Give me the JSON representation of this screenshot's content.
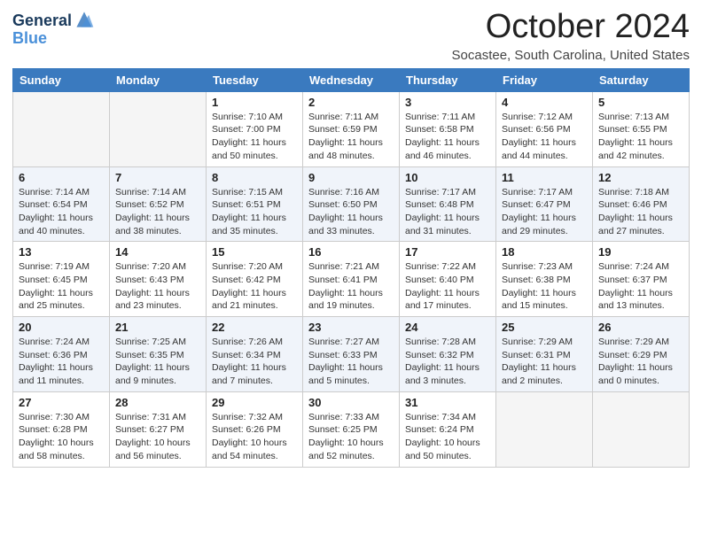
{
  "logo": {
    "line1": "General",
    "line2": "Blue"
  },
  "title": "October 2024",
  "subtitle": "Socastee, South Carolina, United States",
  "days_of_week": [
    "Sunday",
    "Monday",
    "Tuesday",
    "Wednesday",
    "Thursday",
    "Friday",
    "Saturday"
  ],
  "weeks": [
    [
      {
        "day": "",
        "empty": true
      },
      {
        "day": "",
        "empty": true
      },
      {
        "day": "1",
        "sunrise": "Sunrise: 7:10 AM",
        "sunset": "Sunset: 7:00 PM",
        "daylight": "Daylight: 11 hours and 50 minutes."
      },
      {
        "day": "2",
        "sunrise": "Sunrise: 7:11 AM",
        "sunset": "Sunset: 6:59 PM",
        "daylight": "Daylight: 11 hours and 48 minutes."
      },
      {
        "day": "3",
        "sunrise": "Sunrise: 7:11 AM",
        "sunset": "Sunset: 6:58 PM",
        "daylight": "Daylight: 11 hours and 46 minutes."
      },
      {
        "day": "4",
        "sunrise": "Sunrise: 7:12 AM",
        "sunset": "Sunset: 6:56 PM",
        "daylight": "Daylight: 11 hours and 44 minutes."
      },
      {
        "day": "5",
        "sunrise": "Sunrise: 7:13 AM",
        "sunset": "Sunset: 6:55 PM",
        "daylight": "Daylight: 11 hours and 42 minutes."
      }
    ],
    [
      {
        "day": "6",
        "sunrise": "Sunrise: 7:14 AM",
        "sunset": "Sunset: 6:54 PM",
        "daylight": "Daylight: 11 hours and 40 minutes."
      },
      {
        "day": "7",
        "sunrise": "Sunrise: 7:14 AM",
        "sunset": "Sunset: 6:52 PM",
        "daylight": "Daylight: 11 hours and 38 minutes."
      },
      {
        "day": "8",
        "sunrise": "Sunrise: 7:15 AM",
        "sunset": "Sunset: 6:51 PM",
        "daylight": "Daylight: 11 hours and 35 minutes."
      },
      {
        "day": "9",
        "sunrise": "Sunrise: 7:16 AM",
        "sunset": "Sunset: 6:50 PM",
        "daylight": "Daylight: 11 hours and 33 minutes."
      },
      {
        "day": "10",
        "sunrise": "Sunrise: 7:17 AM",
        "sunset": "Sunset: 6:48 PM",
        "daylight": "Daylight: 11 hours and 31 minutes."
      },
      {
        "day": "11",
        "sunrise": "Sunrise: 7:17 AM",
        "sunset": "Sunset: 6:47 PM",
        "daylight": "Daylight: 11 hours and 29 minutes."
      },
      {
        "day": "12",
        "sunrise": "Sunrise: 7:18 AM",
        "sunset": "Sunset: 6:46 PM",
        "daylight": "Daylight: 11 hours and 27 minutes."
      }
    ],
    [
      {
        "day": "13",
        "sunrise": "Sunrise: 7:19 AM",
        "sunset": "Sunset: 6:45 PM",
        "daylight": "Daylight: 11 hours and 25 minutes."
      },
      {
        "day": "14",
        "sunrise": "Sunrise: 7:20 AM",
        "sunset": "Sunset: 6:43 PM",
        "daylight": "Daylight: 11 hours and 23 minutes."
      },
      {
        "day": "15",
        "sunrise": "Sunrise: 7:20 AM",
        "sunset": "Sunset: 6:42 PM",
        "daylight": "Daylight: 11 hours and 21 minutes."
      },
      {
        "day": "16",
        "sunrise": "Sunrise: 7:21 AM",
        "sunset": "Sunset: 6:41 PM",
        "daylight": "Daylight: 11 hours and 19 minutes."
      },
      {
        "day": "17",
        "sunrise": "Sunrise: 7:22 AM",
        "sunset": "Sunset: 6:40 PM",
        "daylight": "Daylight: 11 hours and 17 minutes."
      },
      {
        "day": "18",
        "sunrise": "Sunrise: 7:23 AM",
        "sunset": "Sunset: 6:38 PM",
        "daylight": "Daylight: 11 hours and 15 minutes."
      },
      {
        "day": "19",
        "sunrise": "Sunrise: 7:24 AM",
        "sunset": "Sunset: 6:37 PM",
        "daylight": "Daylight: 11 hours and 13 minutes."
      }
    ],
    [
      {
        "day": "20",
        "sunrise": "Sunrise: 7:24 AM",
        "sunset": "Sunset: 6:36 PM",
        "daylight": "Daylight: 11 hours and 11 minutes."
      },
      {
        "day": "21",
        "sunrise": "Sunrise: 7:25 AM",
        "sunset": "Sunset: 6:35 PM",
        "daylight": "Daylight: 11 hours and 9 minutes."
      },
      {
        "day": "22",
        "sunrise": "Sunrise: 7:26 AM",
        "sunset": "Sunset: 6:34 PM",
        "daylight": "Daylight: 11 hours and 7 minutes."
      },
      {
        "day": "23",
        "sunrise": "Sunrise: 7:27 AM",
        "sunset": "Sunset: 6:33 PM",
        "daylight": "Daylight: 11 hours and 5 minutes."
      },
      {
        "day": "24",
        "sunrise": "Sunrise: 7:28 AM",
        "sunset": "Sunset: 6:32 PM",
        "daylight": "Daylight: 11 hours and 3 minutes."
      },
      {
        "day": "25",
        "sunrise": "Sunrise: 7:29 AM",
        "sunset": "Sunset: 6:31 PM",
        "daylight": "Daylight: 11 hours and 2 minutes."
      },
      {
        "day": "26",
        "sunrise": "Sunrise: 7:29 AM",
        "sunset": "Sunset: 6:29 PM",
        "daylight": "Daylight: 11 hours and 0 minutes."
      }
    ],
    [
      {
        "day": "27",
        "sunrise": "Sunrise: 7:30 AM",
        "sunset": "Sunset: 6:28 PM",
        "daylight": "Daylight: 10 hours and 58 minutes."
      },
      {
        "day": "28",
        "sunrise": "Sunrise: 7:31 AM",
        "sunset": "Sunset: 6:27 PM",
        "daylight": "Daylight: 10 hours and 56 minutes."
      },
      {
        "day": "29",
        "sunrise": "Sunrise: 7:32 AM",
        "sunset": "Sunset: 6:26 PM",
        "daylight": "Daylight: 10 hours and 54 minutes."
      },
      {
        "day": "30",
        "sunrise": "Sunrise: 7:33 AM",
        "sunset": "Sunset: 6:25 PM",
        "daylight": "Daylight: 10 hours and 52 minutes."
      },
      {
        "day": "31",
        "sunrise": "Sunrise: 7:34 AM",
        "sunset": "Sunset: 6:24 PM",
        "daylight": "Daylight: 10 hours and 50 minutes."
      },
      {
        "day": "",
        "empty": true
      },
      {
        "day": "",
        "empty": true
      }
    ]
  ]
}
